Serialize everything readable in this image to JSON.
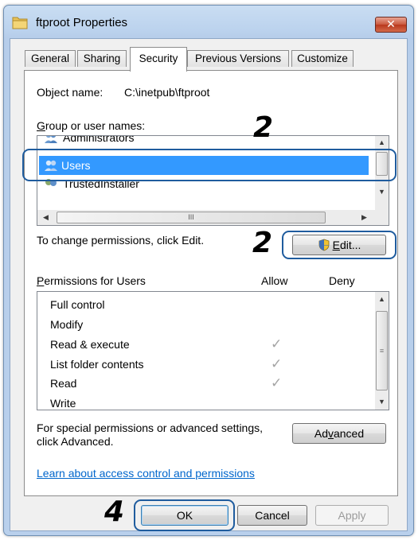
{
  "window": {
    "title": "ftproot Properties",
    "close_glyph": "✕"
  },
  "tabs": [
    {
      "label": "General"
    },
    {
      "label": "Sharing"
    },
    {
      "label": "Security",
      "active": true
    },
    {
      "label": "Previous Versions"
    },
    {
      "label": "Customize"
    }
  ],
  "object": {
    "label": "Object name:",
    "value": "C:\\inetpub\\ftproot"
  },
  "group_users": {
    "label_ul": "G",
    "label_rest": "roup or user names:",
    "items": [
      {
        "name": "Administrators",
        "icon": "users-group-icon"
      },
      {
        "name": "Users",
        "icon": "users-group-icon",
        "selected": true
      },
      {
        "name": "TrustedInstaller",
        "icon": "trusted-installer-icon"
      }
    ],
    "hscroll_label": "III"
  },
  "change_perms": {
    "text": "To change permissions, click Edit.",
    "edit_ul": "E",
    "edit_rest": "dit..."
  },
  "permissions": {
    "label_ul": "P",
    "label_rest": "ermissions for Users",
    "allow_header": "Allow",
    "deny_header": "Deny",
    "rows": [
      {
        "name": "Full control",
        "allow": false,
        "deny": false
      },
      {
        "name": "Modify",
        "allow": false,
        "deny": false
      },
      {
        "name": "Read & execute",
        "allow": true,
        "deny": false
      },
      {
        "name": "List folder contents",
        "allow": true,
        "deny": false
      },
      {
        "name": "Read",
        "allow": true,
        "deny": false
      },
      {
        "name": "Write",
        "allow": false,
        "deny": false
      }
    ],
    "check_glyph": "✓"
  },
  "advanced": {
    "text_line1": "For special permissions or advanced settings,",
    "text_line2": "click Advanced.",
    "button_pre": "Ad",
    "button_ul": "v",
    "button_post": "anced"
  },
  "learn_link": "Learn about access control and permissions",
  "buttons": {
    "ok": "OK",
    "cancel": "Cancel",
    "apply": "Apply"
  },
  "callouts": {
    "users_step": "2",
    "edit_step": "2",
    "ok_step": "4"
  },
  "colors": {
    "highlight_box": "#1f5c9e",
    "selection": "#3399ff",
    "link": "#0066cc",
    "close_button": "#c9573c"
  }
}
